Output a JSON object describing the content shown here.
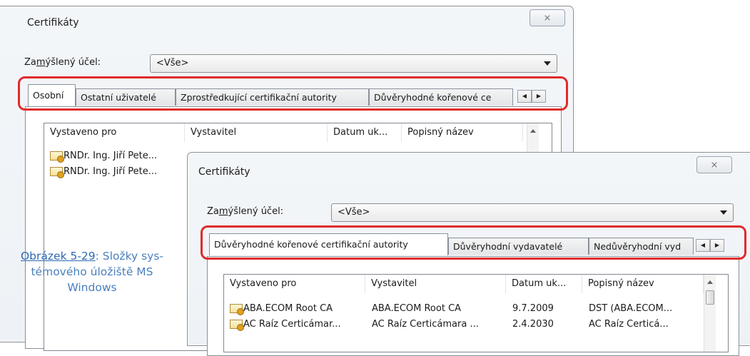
{
  "dialog_back": {
    "title": "Certifikáty",
    "close_label": "⨯",
    "purpose_label_pre": "Za",
    "purpose_label_mnemonic": "m",
    "purpose_label_post": "ýšlený účel:",
    "purpose_value": "<Vše>",
    "tabs": [
      "Osobní",
      "Ostatní uživatelé",
      "Zprostředkující certifikační autority",
      "Důvěryhodné kořenové ce"
    ],
    "columns": [
      "Vystaveno pro",
      "Vystavitel",
      "Datum uk...",
      "Popisný název"
    ],
    "rows": [
      {
        "issued_to": "RNDr. Ing. Jiří Pete..."
      },
      {
        "issued_to": "RNDr. Ing. Jiří Pete..."
      }
    ]
  },
  "dialog_front": {
    "title": "Certifikáty",
    "close_label": "⨯",
    "purpose_label_pre": "Za",
    "purpose_label_mnemonic": "m",
    "purpose_label_post": "ýšlený účel:",
    "purpose_value": "<Vše>",
    "tabs": [
      "Důvěryhodné kořenové certifikační autority",
      "Důvěryhodní vydavatelé",
      "Nedůvěryhodní vyd"
    ],
    "columns": [
      "Vystaveno pro",
      "Vystavitel",
      "Datum uk...",
      "Popisný název"
    ],
    "rows": [
      {
        "issued_to": "ABA.ECOM Root CA",
        "issuer": "ABA.ECOM Root CA",
        "date": "9.7.2009",
        "name": "DST (ABA.ECOM..."
      },
      {
        "issued_to": "AC Raíz Certicámar...",
        "issuer": "AC Raíz Certicámara ...",
        "date": "2.4.2030",
        "name": "AC Raíz Certicá..."
      }
    ]
  },
  "caption": {
    "ref": "Obrázek 5-29",
    "text": ": Složky sys-\ntémového úložiště MS\nWindows"
  },
  "colors": {
    "highlight": "#e02b2b",
    "caption": "#4a7fbf"
  },
  "icons": [
    "certificate-icon",
    "close-icon",
    "dropdown-arrow-icon",
    "scroll-left-icon",
    "scroll-right-icon",
    "scroll-up-icon"
  ]
}
